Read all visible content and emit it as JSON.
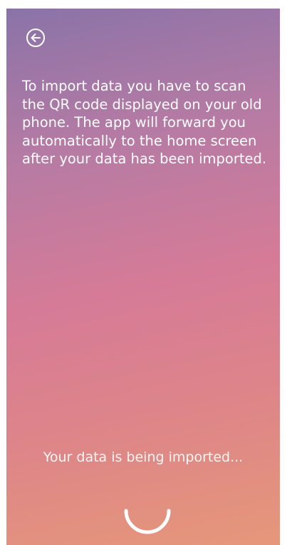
{
  "header": {
    "back_icon": "arrow-left-circle-icon"
  },
  "main": {
    "instructions": "To import data you have to scan the QR code displayed on your old phone. The app will forward you automatically to the home screen after your data has been imported.",
    "status_text": "Your data is being imported...",
    "spinner_icon": "loading-spinner-icon"
  },
  "colors": {
    "gradient_top": "#8a73a8",
    "gradient_middle": "#d67b97",
    "gradient_bottom": "#e6977a",
    "text": "#ffffff"
  }
}
